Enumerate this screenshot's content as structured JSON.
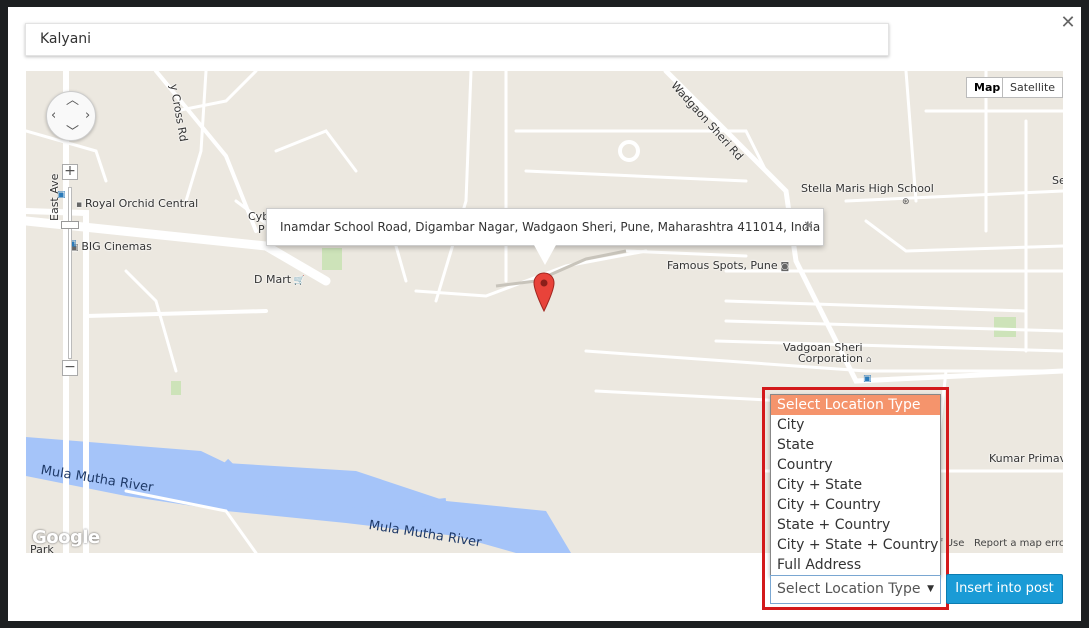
{
  "modal": {
    "close_icon": "close-icon"
  },
  "search": {
    "value": "Kalyani"
  },
  "map": {
    "type_buttons": [
      "Map",
      "Satellite"
    ],
    "active_type": "Map",
    "zoom_in": "+",
    "zoom_out": "−",
    "infowindow": {
      "address": "Inamdar School Road, Digambar Nagar, Wadgaon Sheri, Pune, Maharashtra 411014, India",
      "close": "✕"
    },
    "labels": {
      "east_ave": "East Ave",
      "cross_rd": "y Cross Rd",
      "wadgaon_sheri_rd": "Wadgaon Sheri Rd",
      "royal_orchid": "Royal Orchid Central",
      "big_cinemas": "BIG Cinemas",
      "cyb_top": "Cyb",
      "cyb_bottom": "P",
      "d_mart": "D Mart",
      "stella_maris": "Stella Maris High School",
      "famous_spots": "Famous Spots, Pune",
      "wadgaon_corp_line1": "Vadgoan Sheri",
      "wadgaon_corp_line2": "Corporation",
      "kumar_primavera": "Kumar Primave",
      "se": "Se",
      "river1": "Mula Mutha River",
      "river2": "Mula Mutha River",
      "park": "Park"
    },
    "footer": {
      "google": "Google",
      "terms": "f Use",
      "report": "Report a map error"
    }
  },
  "location_type": {
    "selected": "Select Location Type",
    "options": [
      "Select Location Type",
      "City",
      "State",
      "Country",
      "City + State",
      "City + Country",
      "State + Country",
      "City + State + Country",
      "Full Address"
    ]
  },
  "insert_button": "Insert into post",
  "colors": {
    "highlight_border": "#d3191b",
    "selected_option": "#f5946c",
    "insert_button": "#1a9bd6",
    "river": "#a5c4f9"
  }
}
